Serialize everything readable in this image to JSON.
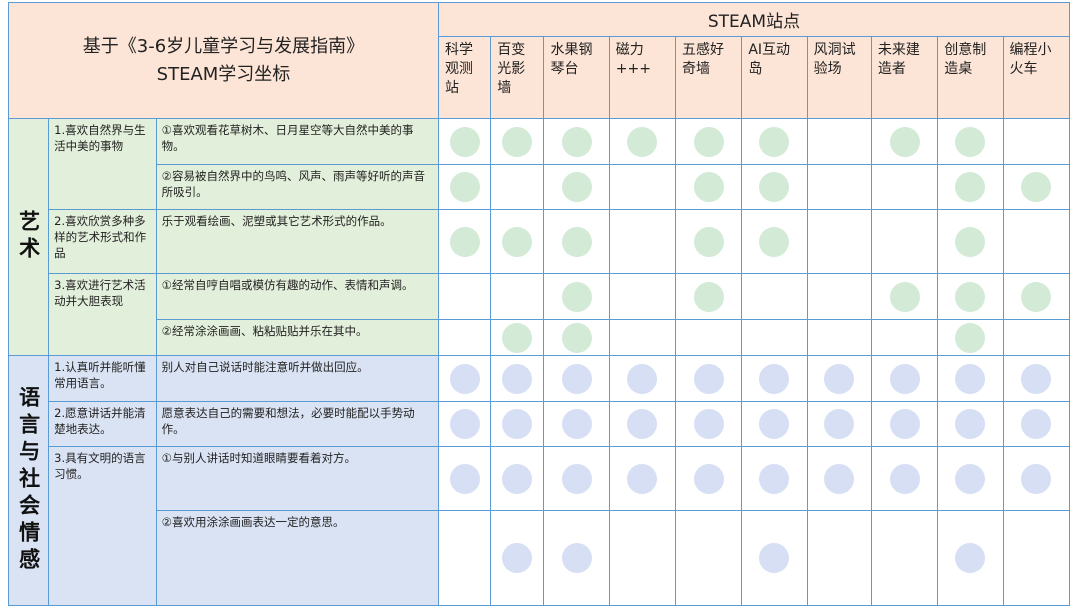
{
  "header": {
    "title_line1": "基于《3-6岁儿童学习与发展指南》",
    "title_line2": "STEAM学习坐标",
    "stations_title": "STEAM站点",
    "stations": [
      "科学观测站",
      "百变光影墙",
      "水果钢琴台",
      "磁力+++",
      "五感好奇墙",
      "AI互动岛",
      "风洞试验场",
      "未来建造者",
      "创意制造桌",
      "编程小火车"
    ]
  },
  "sections": [
    {
      "domain": "艺术",
      "theme": "green",
      "goals": [
        {
          "goal": "1.喜欢自然界与生活中美的事物",
          "indicators": [
            {
              "text": "①喜欢观看花草树木、日月星空等大自然中美的事物。",
              "marks": [
                1,
                1,
                1,
                1,
                1,
                1,
                0,
                1,
                1,
                0
              ]
            },
            {
              "text": "②容易被自然界中的鸟鸣、风声、雨声等好听的声音所吸引。",
              "marks": [
                1,
                0,
                1,
                0,
                1,
                1,
                0,
                0,
                1,
                1
              ]
            }
          ]
        },
        {
          "goal": "2.喜欢欣赏多种多样的艺术形式和作品",
          "indicators": [
            {
              "text": "乐于观看绘画、泥塑或其它艺术形式的作品。",
              "marks": [
                1,
                1,
                1,
                0,
                1,
                1,
                0,
                0,
                1,
                0
              ]
            }
          ]
        },
        {
          "goal": "3.喜欢进行艺术活动并大胆表现",
          "indicators": [
            {
              "text": "①经常自哼自唱或模仿有趣的动作、表情和声调。",
              "marks": [
                0,
                0,
                1,
                0,
                1,
                0,
                0,
                1,
                1,
                1
              ]
            },
            {
              "text": "②经常涂涂画画、粘粘贴贴并乐在其中。",
              "marks": [
                0,
                1,
                1,
                0,
                0,
                0,
                0,
                0,
                1,
                0
              ]
            }
          ]
        }
      ]
    },
    {
      "domain": "语言与社会情感",
      "theme": "blue",
      "goals": [
        {
          "goal": "1.认真听并能听懂常用语言。",
          "indicators": [
            {
              "text": "别人对自己说话时能注意听并做出回应。",
              "marks": [
                1,
                1,
                1,
                1,
                1,
                1,
                1,
                1,
                1,
                1
              ]
            }
          ]
        },
        {
          "goal": "2.愿意讲话并能清楚地表达。",
          "indicators": [
            {
              "text": "愿意表达自己的需要和想法，必要时能配以手势动作。",
              "marks": [
                1,
                1,
                1,
                1,
                1,
                1,
                1,
                1,
                1,
                1
              ]
            }
          ]
        },
        {
          "goal": "3.具有文明的语言习惯。",
          "indicators": [
            {
              "text": "①与别人讲话时知道眼睛要看着对方。",
              "marks": [
                1,
                1,
                1,
                1,
                1,
                1,
                1,
                1,
                1,
                1
              ]
            },
            {
              "text": "②喜欢用涂涂画画表达一定的意思。",
              "marks": [
                0,
                1,
                1,
                0,
                0,
                1,
                0,
                0,
                1,
                0
              ]
            }
          ]
        }
      ]
    }
  ]
}
